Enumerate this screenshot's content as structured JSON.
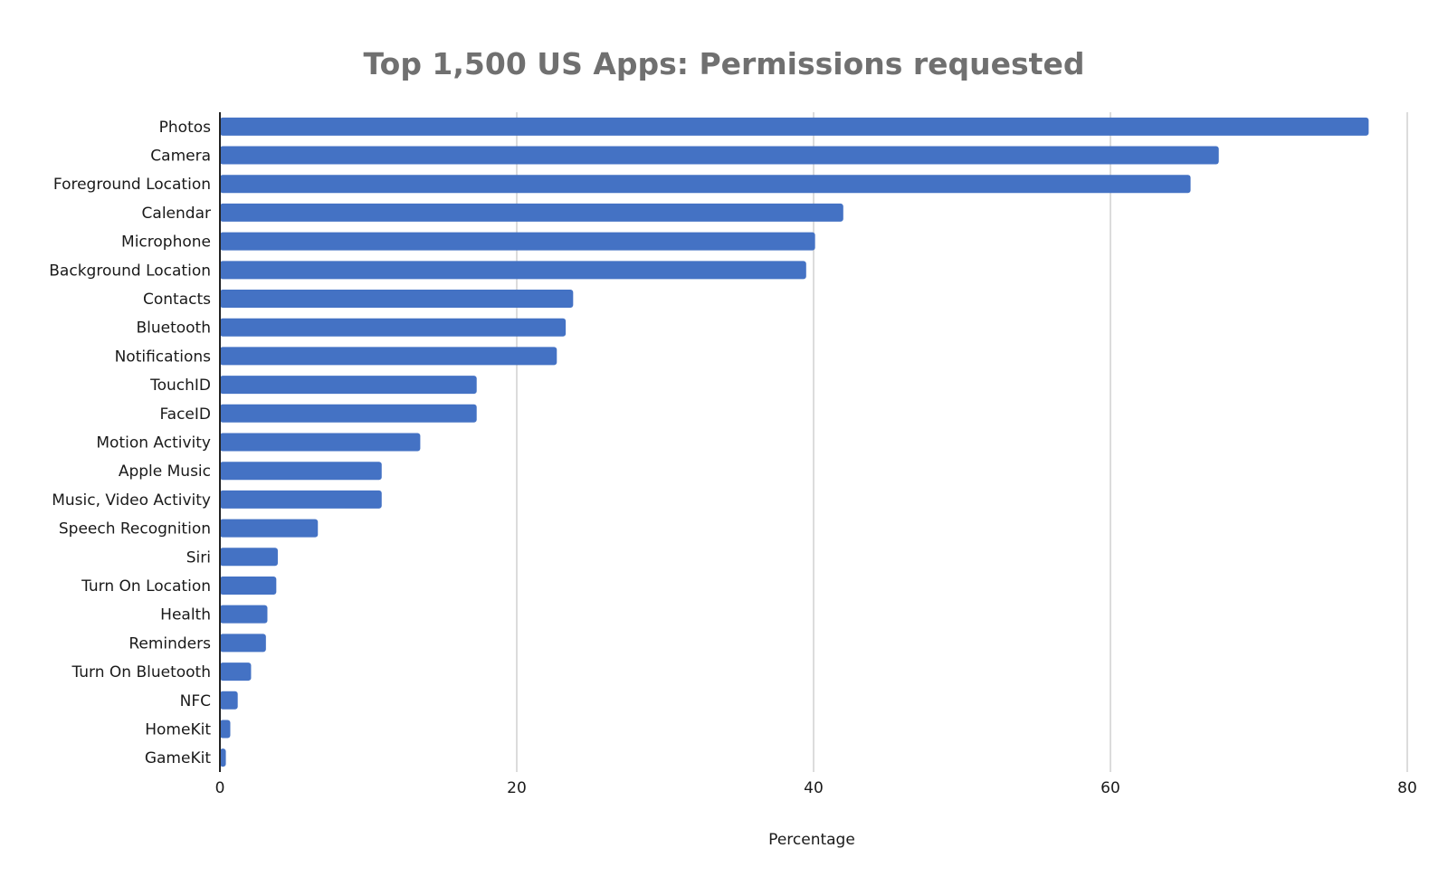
{
  "chart_data": {
    "type": "bar",
    "orientation": "horizontal",
    "title": "Top 1,500 US Apps: Permissions requested",
    "xlabel": "Percentage",
    "ylabel": "",
    "xlim": [
      0,
      80
    ],
    "xticks": [
      0,
      20,
      40,
      60,
      80
    ],
    "grid": true,
    "legend": "none",
    "bar_color": "#4472C4",
    "categories": [
      "Photos",
      "Camera",
      "Foreground Location",
      "Calendar",
      "Microphone",
      "Background Location",
      "Contacts",
      "Bluetooth",
      "Notifications",
      "TouchID",
      "FaceID",
      "Motion Activity",
      "Apple Music",
      "Music, Video Activity",
      "Speech Recognition",
      "Siri",
      "Turn On Location",
      "Health",
      "Reminders",
      "Turn On Bluetooth",
      "NFC",
      "HomeKit",
      "GameKit"
    ],
    "values": [
      77.4,
      67.3,
      65.4,
      42.0,
      40.1,
      39.5,
      23.8,
      23.3,
      22.7,
      17.3,
      17.3,
      13.5,
      10.9,
      10.9,
      6.6,
      3.9,
      3.8,
      3.2,
      3.1,
      2.1,
      1.2,
      0.7,
      0.4
    ]
  }
}
